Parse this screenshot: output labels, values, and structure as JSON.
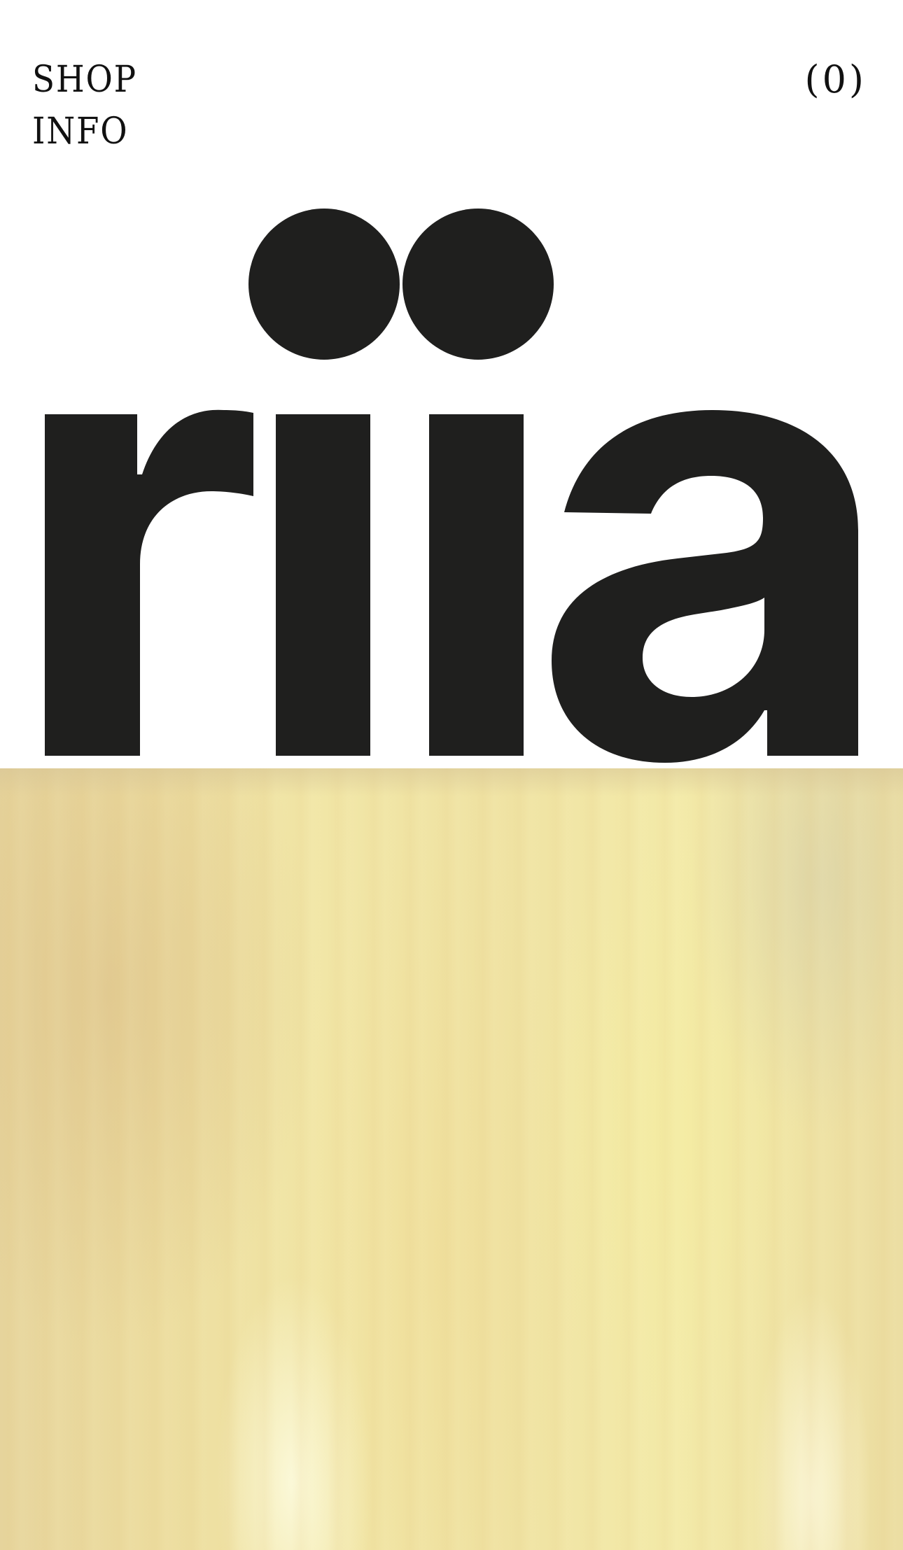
{
  "nav": {
    "shop_label": "SHOP",
    "info_label": "INFO"
  },
  "cart": {
    "label": "(0)",
    "count": 0
  },
  "brand": {
    "logo_text": "riia",
    "logo_color": "#1f1f1e"
  },
  "hero": {
    "description_colors": [
      "#e6d49c",
      "#f1e6a6",
      "#f7f1c8"
    ]
  }
}
